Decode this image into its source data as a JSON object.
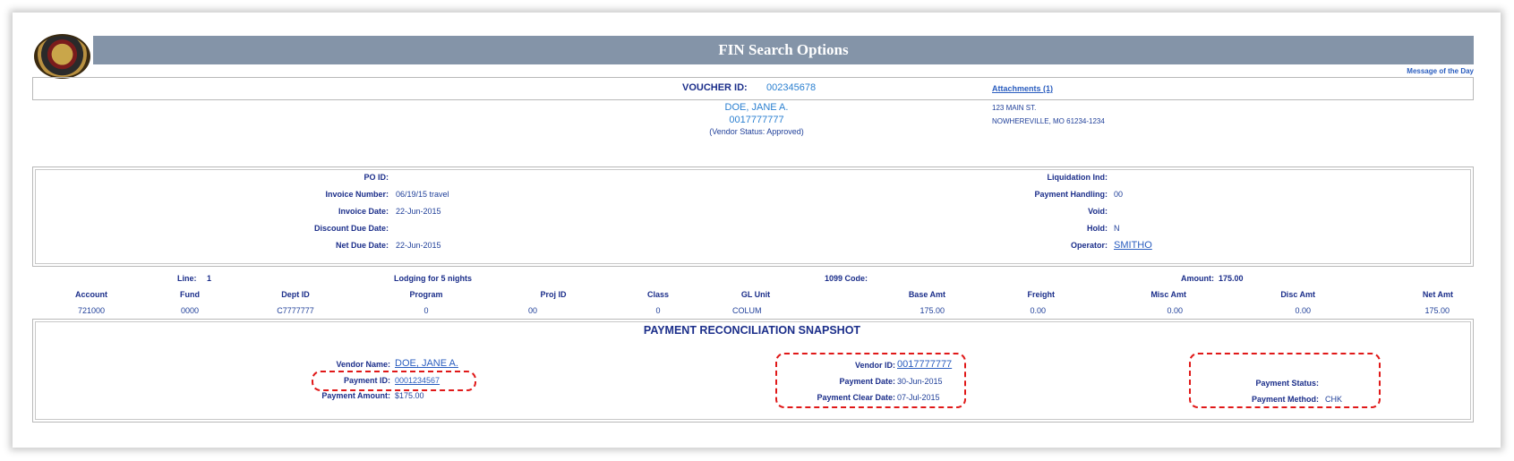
{
  "header": {
    "title": "FIN Search Options",
    "message_of_day": "Message of the Day"
  },
  "voucher": {
    "label": "VOUCHER ID:",
    "id": "002345678",
    "attachments": "Attachments (1)"
  },
  "vendor": {
    "name": "DOE, JANE A.",
    "id": "0017777777",
    "status": "(Vendor Status: Approved)",
    "address1": "123 MAIN ST.",
    "address2": "NOWHEREVILLE, MO 61234-1234"
  },
  "invoice": {
    "po_id_label": "PO ID:",
    "po_id": "",
    "invoice_number_label": "Invoice Number:",
    "invoice_number": "06/19/15 travel",
    "invoice_date_label": "Invoice Date:",
    "invoice_date": "22-Jun-2015",
    "discount_due_label": "Discount Due Date:",
    "discount_due": "",
    "net_due_label": "Net Due Date:",
    "net_due": "22-Jun-2015",
    "liquidation_label": "Liquidation Ind:",
    "liquidation": "",
    "payment_handling_label": "Payment Handling:",
    "payment_handling": "00",
    "void_label": "Void:",
    "void": "",
    "hold_label": "Hold:",
    "hold": "N",
    "operator_label": "Operator:",
    "operator": "SMITHO"
  },
  "line": {
    "line_label": "Line:",
    "line": "1",
    "description": "Lodging for 5 nights",
    "code_1099_label": "1099 Code:",
    "code_1099": "",
    "amount_label": "Amount:",
    "amount": "175.00"
  },
  "table": {
    "headers": [
      "Account",
      "Fund",
      "Dept ID",
      "Program",
      "Proj ID",
      "Class",
      "GL Unit",
      "Base Amt",
      "Freight",
      "Misc Amt",
      "Disc Amt",
      "Net Amt"
    ],
    "row": [
      "721000",
      "0000",
      "C7777777",
      "0",
      "00",
      "0",
      "COLUM",
      "175.00",
      "0.00",
      "0.00",
      "0.00",
      "175.00"
    ]
  },
  "snapshot": {
    "title": "PAYMENT RECONCILIATION SNAPSHOT",
    "vendor_name_label": "Vendor Name:",
    "vendor_name": "DOE, JANE A.",
    "payment_id_label": "Payment ID:",
    "payment_id": "0001234567",
    "payment_amount_label": "Payment Amount:",
    "payment_amount": "$175.00",
    "vendor_id_label": "Vendor ID:",
    "vendor_id": "0017777777",
    "payment_date_label": "Payment Date:",
    "payment_date": "30-Jun-2015",
    "clear_date_label": "Payment Clear Date:",
    "clear_date": "07-Jul-2015",
    "status_label": "Payment Status:",
    "status": "",
    "method_label": "Payment Method:",
    "method": "CHK"
  },
  "colors": {
    "title_bar": "#8494a8",
    "label": "#1b2e8a",
    "highlight": "#e01818"
  }
}
